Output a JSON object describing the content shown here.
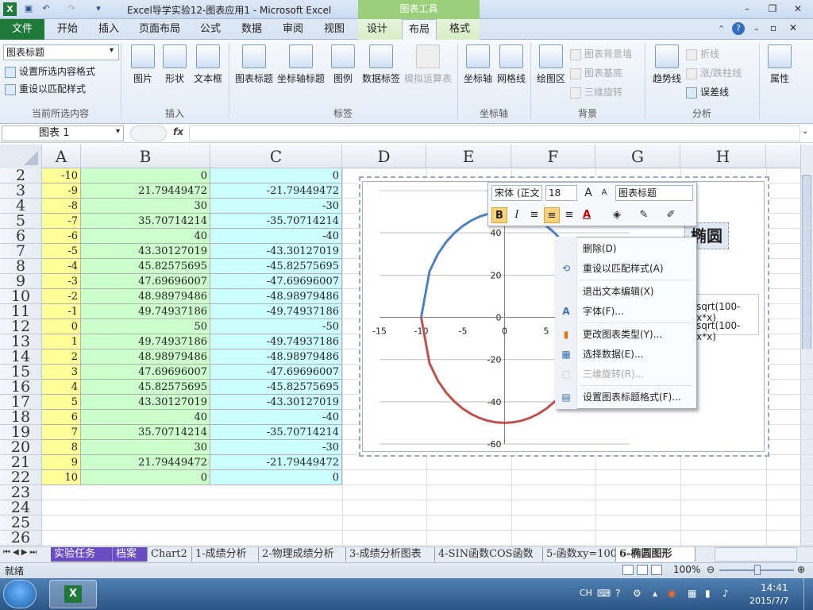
{
  "window": {
    "title": "Excel导学实验12-图表应用1  -  Microsoft Excel",
    "chart_tools_label": "图表工具",
    "quick_access": [
      "save-icon",
      "undo-icon",
      "redo-icon",
      "customize-icon"
    ],
    "buttons": [
      "minimize",
      "restore",
      "close"
    ]
  },
  "ribbon_tabs": {
    "file": "文件",
    "tabs": [
      "开始",
      "插入",
      "页面布局",
      "公式",
      "数据",
      "审阅",
      "视图",
      "设计",
      "布局",
      "格式"
    ],
    "active": "布局"
  },
  "ribbon": {
    "current_selection": {
      "selector_value": "图表标题",
      "format_selection": "设置所选内容格式",
      "reset_style": "重设以匹配样式",
      "group": "当前所选内容"
    },
    "insert": {
      "picture": "图片",
      "shapes": "形状",
      "textbox": "文本框",
      "group": "插入"
    },
    "labels": {
      "chart_title": "图表标题",
      "axis_titles": "坐标轴标题",
      "legend": "图例",
      "data_labels": "数据标签",
      "data_table": "模拟运算表",
      "group": "标签"
    },
    "axes": {
      "axes": "坐标轴",
      "gridlines": "网格线",
      "group": "坐标轴"
    },
    "background": {
      "plot_area": "绘图区",
      "chart_wall": "图表背景墙",
      "chart_floor": "图表基底",
      "rotation": "三维旋转",
      "group": "背景"
    },
    "analysis": {
      "trendline": "趋势线",
      "lines": "折线",
      "updown": "涨/跌柱线",
      "errorbars": "误差线",
      "group": "分析"
    },
    "properties": {
      "label": "属性"
    }
  },
  "formula_bar": {
    "name_box": "图表 1",
    "fx": "fx",
    "content": ""
  },
  "columns": [
    "A",
    "B",
    "C",
    "D",
    "E",
    "F",
    "G",
    "H"
  ],
  "rows": [
    {
      "n": "2",
      "a": "-10",
      "b": "0",
      "c": "0"
    },
    {
      "n": "3",
      "a": "-9",
      "b": "21.79449472",
      "c": "-21.79449472"
    },
    {
      "n": "4",
      "a": "-8",
      "b": "30",
      "c": "-30"
    },
    {
      "n": "5",
      "a": "-7",
      "b": "35.70714214",
      "c": "-35.70714214"
    },
    {
      "n": "6",
      "a": "-6",
      "b": "40",
      "c": "-40"
    },
    {
      "n": "7",
      "a": "-5",
      "b": "43.30127019",
      "c": "-43.30127019"
    },
    {
      "n": "8",
      "a": "-4",
      "b": "45.82575695",
      "c": "-45.82575695"
    },
    {
      "n": "9",
      "a": "-3",
      "b": "47.69696007",
      "c": "-47.69696007"
    },
    {
      "n": "10",
      "a": "-2",
      "b": "48.98979486",
      "c": "-48.98979486"
    },
    {
      "n": "11",
      "a": "-1",
      "b": "49.74937186",
      "c": "-49.74937186"
    },
    {
      "n": "12",
      "a": "0",
      "b": "50",
      "c": "-50"
    },
    {
      "n": "13",
      "a": "1",
      "b": "49.74937186",
      "c": "-49.74937186"
    },
    {
      "n": "14",
      "a": "2",
      "b": "48.98979486",
      "c": "-48.98979486"
    },
    {
      "n": "15",
      "a": "3",
      "b": "47.69696007",
      "c": "-47.69696007"
    },
    {
      "n": "16",
      "a": "4",
      "b": "45.82575695",
      "c": "-45.82575695"
    },
    {
      "n": "17",
      "a": "5",
      "b": "43.30127019",
      "c": "-43.30127019"
    },
    {
      "n": "18",
      "a": "6",
      "b": "40",
      "c": "-40"
    },
    {
      "n": "19",
      "a": "7",
      "b": "35.70714214",
      "c": "-35.70714214"
    },
    {
      "n": "20",
      "a": "8",
      "b": "30",
      "c": "-30"
    },
    {
      "n": "21",
      "a": "9",
      "b": "21.79449472",
      "c": "-21.79449472"
    },
    {
      "n": "22",
      "a": "10",
      "b": "0",
      "c": "0"
    },
    {
      "n": "23",
      "a": "",
      "b": "",
      "c": ""
    },
    {
      "n": "24",
      "a": "",
      "b": "",
      "c": ""
    },
    {
      "n": "25",
      "a": "",
      "b": "",
      "c": ""
    },
    {
      "n": "26",
      "a": "",
      "b": "",
      "c": ""
    }
  ],
  "chart": {
    "title": "椭圆",
    "legend": [
      "sqrt(100-x*x)",
      "sqrt(100-x*x)"
    ],
    "series_colors": [
      "#4f81bd",
      "#c0504d"
    ]
  },
  "chart_data": {
    "type": "scatter",
    "title": "椭圆",
    "x": [
      -10,
      -9,
      -8,
      -7,
      -6,
      -5,
      -4,
      -3,
      -2,
      -1,
      0,
      1,
      2,
      3,
      4,
      5,
      6,
      7,
      8,
      9,
      10
    ],
    "series": [
      {
        "name": "sqrt(100-x*x)",
        "values": [
          0,
          21.79449472,
          30,
          35.70714214,
          40,
          43.30127019,
          45.82575695,
          47.69696007,
          48.98979486,
          49.74937186,
          50,
          49.74937186,
          48.98979486,
          47.69696007,
          45.82575695,
          43.30127019,
          40,
          35.70714214,
          30,
          21.79449472,
          0
        ]
      },
      {
        "name": "sqrt(100-x*x)",
        "values": [
          0,
          -21.79449472,
          -30,
          -35.70714214,
          -40,
          -43.30127019,
          -45.82575695,
          -47.69696007,
          -48.98979486,
          -49.74937186,
          -50,
          -49.74937186,
          -48.98979486,
          -47.69696007,
          -45.82575695,
          -43.30127019,
          -40,
          -35.70714214,
          -30,
          -21.79449472,
          0
        ]
      }
    ],
    "xlim": [
      -15,
      15
    ],
    "ylim": [
      -60,
      60
    ],
    "x_ticks": [
      "-15",
      "-10",
      "-5",
      "0",
      "5"
    ],
    "y_ticks": [
      "60",
      "40",
      "20",
      "0",
      "-20",
      "-40",
      "-60"
    ],
    "grid": true,
    "legend_position": "right"
  },
  "mini_toolbar": {
    "font": "宋体 (正文",
    "size": "18",
    "element": "图表标题",
    "grow": "A",
    "shrink": "A",
    "bold": "B",
    "italic": "I",
    "font_color": "A"
  },
  "context_menu": {
    "items": [
      {
        "label": "删除(D)",
        "icon": "",
        "disabled": false
      },
      {
        "label": "重设以匹配样式(A)",
        "icon": "reset-style-icon",
        "disabled": false
      },
      {
        "label": "退出文本编辑(X)",
        "icon": "",
        "disabled": false
      },
      {
        "label": "字体(F)...",
        "icon": "font-icon",
        "disabled": false
      },
      {
        "label": "更改图表类型(Y)...",
        "icon": "chart-type-icon",
        "disabled": false
      },
      {
        "label": "选择数据(E)...",
        "icon": "select-data-icon",
        "disabled": false
      },
      {
        "label": "三维旋转(R)...",
        "icon": "rotation-icon",
        "disabled": true
      },
      {
        "label": "设置图表标题格式(F)...",
        "icon": "format-title-icon",
        "disabled": false
      }
    ]
  },
  "sheets": [
    "实验任务",
    "档案",
    "Chart2",
    "1-成绩分析",
    "2-物理成绩分析",
    "3-成绩分析图表",
    "4-SIN函数COS函数",
    "5-函数xy=100",
    "6-椭圆图形"
  ],
  "active_sheet": "6-椭圆图形",
  "status": {
    "ready": "就绪",
    "zoom": "100%"
  },
  "taskbar": {
    "lang": "CH",
    "time": "14:41",
    "date": "2015/7/7"
  }
}
